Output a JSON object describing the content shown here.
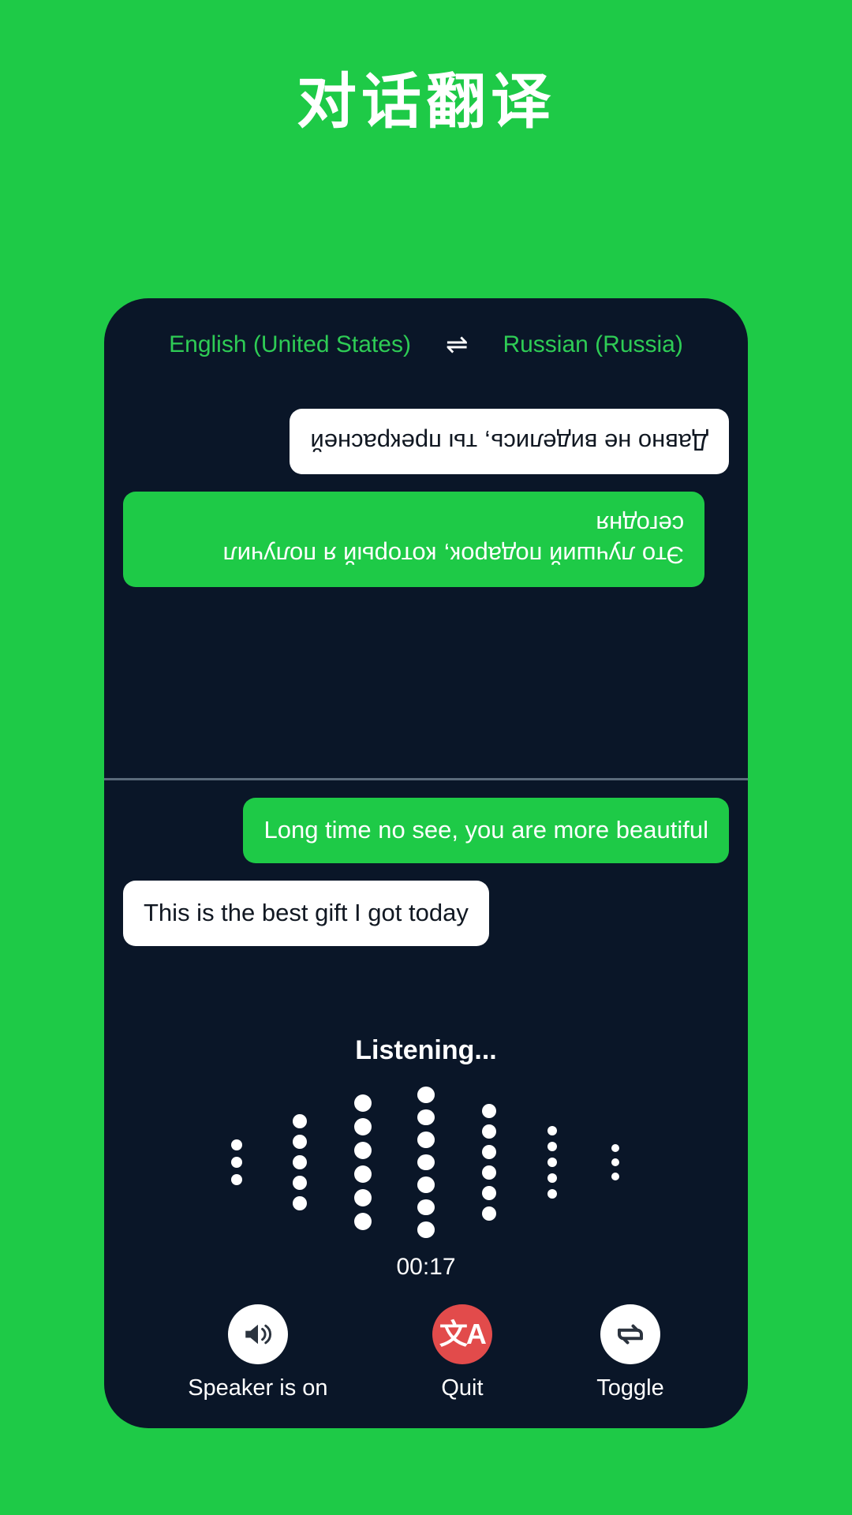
{
  "page": {
    "title": "对话翻译",
    "background_color": "#1ECA47"
  },
  "card": {
    "background_color": "#0A1628",
    "accent_color": "#1ECA47"
  },
  "language_bar": {
    "source_language": "English (United States)",
    "target_language": "Russian (Russia)",
    "swap_icon": "swap-horizontal-icon",
    "swap_glyph": "⇌",
    "text_color": "#2ECC55"
  },
  "conversation": {
    "top_pane_rotated": true,
    "top_pane_messages": [
      {
        "text": "Это лучший подарок, который я получил сегодня",
        "style": "source",
        "align": "right",
        "language": "Russian (Russia)"
      },
      {
        "text": "Давно не виделись, ты прекрасней",
        "style": "target",
        "align": "left",
        "language": "Russian (Russia)"
      }
    ],
    "bottom_pane_messages": [
      {
        "text": "Long time no see, you are more beautiful",
        "style": "source",
        "align": "right",
        "language": "English (United States)"
      },
      {
        "text": "This is the best gift I got today",
        "style": "target",
        "align": "left",
        "language": "English (United States)"
      }
    ]
  },
  "mic": {
    "status_label": "Listening...",
    "timer": "00:17",
    "waveform": {
      "columns": [
        {
          "dots": 3,
          "dot_size": 14
        },
        {
          "dots": 5,
          "dot_size": 18
        },
        {
          "dots": 6,
          "dot_size": 22
        },
        {
          "dots": 7,
          "dot_size": 22
        },
        {
          "dots": 6,
          "dot_size": 18
        },
        {
          "dots": 5,
          "dot_size": 12
        },
        {
          "dots": 3,
          "dot_size": 10
        }
      ],
      "dot_color": "#ffffff"
    }
  },
  "controls": [
    {
      "label": "Speaker is on",
      "icon": "speaker-on-icon",
      "circle_color": "#ffffff",
      "icon_color": "#2B333E"
    },
    {
      "label": "Quit",
      "icon": "translate-icon",
      "glyph": "文A",
      "circle_color": "#E24B4B",
      "icon_color": "#ffffff"
    },
    {
      "label": "Toggle",
      "icon": "repeat-arrows-icon",
      "circle_color": "#ffffff",
      "icon_color": "#2B333E"
    }
  ]
}
